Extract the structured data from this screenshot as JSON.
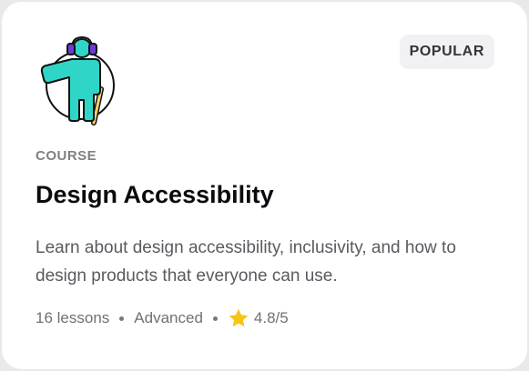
{
  "card": {
    "badge": "POPULAR",
    "category": "COURSE",
    "title": "Design Accessibility",
    "description": "Learn about design accessibility, inclusivity, and how to design products that everyone can use.",
    "meta": {
      "lessons": "16 lessons",
      "level": "Advanced",
      "rating": "4.8/5"
    },
    "illustration_icon": "accessibility-person-icon",
    "rating_icon": "star-icon"
  },
  "colors": {
    "figure_teal": "#2fd6c7",
    "headphones_purple": "#6d3ad6",
    "cane_yellow": "#f5d36a",
    "star_gold": "#f5c518"
  }
}
